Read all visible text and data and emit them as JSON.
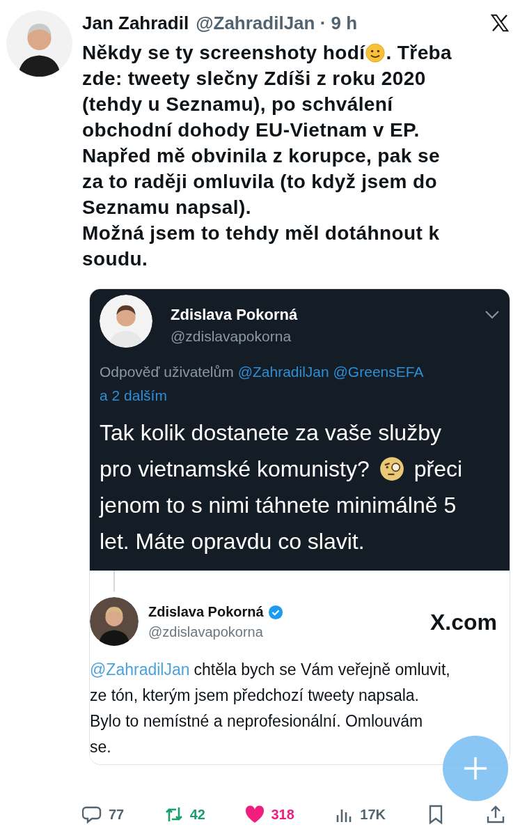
{
  "author": {
    "name": "Jan Zahradil",
    "meta": "@ZahradilJan · 9 h"
  },
  "text": {
    "first_line": {
      "before_emoji": "Někdy se ty screenshoty hodí",
      "after_emoji": ". Třeba"
    },
    "lines": [
      "zde: tweety slečny Zdíši z roku 2020",
      "(tehdy u Seznamu), po schválení",
      "obchodní dohody EU-Vietnam v EP.",
      "Napřed mě obvinila z korupce, pak se",
      "za to raději omluvila (to když jsem do",
      "Seznamu napsal).",
      "Možná jsem to tehdy měl dotáhnout k",
      "soudu."
    ]
  },
  "screenshot_top": {
    "name": "Zdislava Pokorná",
    "handle": "@zdislavapokorna",
    "reply_label": "Odpověď uživatelům",
    "reply_to": [
      "@ZahradilJan @GreensEFA",
      "a 2 dalším"
    ],
    "first_line": "Tak kolik dostanete za vaše služby",
    "emoji_line": {
      "before_emoji": "pro vietnamské komunisty?",
      "after_emoji": "přeci"
    },
    "lines": [
      "jenom to s nimi táhnete minimálně 5",
      "let. Máte opravdu co slavit."
    ]
  },
  "screenshot_bottom": {
    "name": "Zdislava Pokorná",
    "verified": true,
    "handle": "@zdislavapokorna",
    "site": "X.com",
    "mention": "@ZahradilJan",
    "first_line": "chtěla bych se Vám veřejně omluvit,",
    "lines": [
      "ze tón, kterým jsem předchozí tweety napsala.",
      "Bylo to nemístné a neprofesionální. Omlouvám",
      "se."
    ]
  },
  "actions": [
    {
      "kind": "reply",
      "count": "77"
    },
    {
      "kind": "repost",
      "count": "42",
      "color": "#1a9e6b"
    },
    {
      "kind": "like",
      "count": "318",
      "color": "#f01f7e"
    },
    {
      "kind": "views",
      "count": "17K"
    },
    {
      "kind": "bookmark"
    },
    {
      "kind": "share"
    }
  ]
}
